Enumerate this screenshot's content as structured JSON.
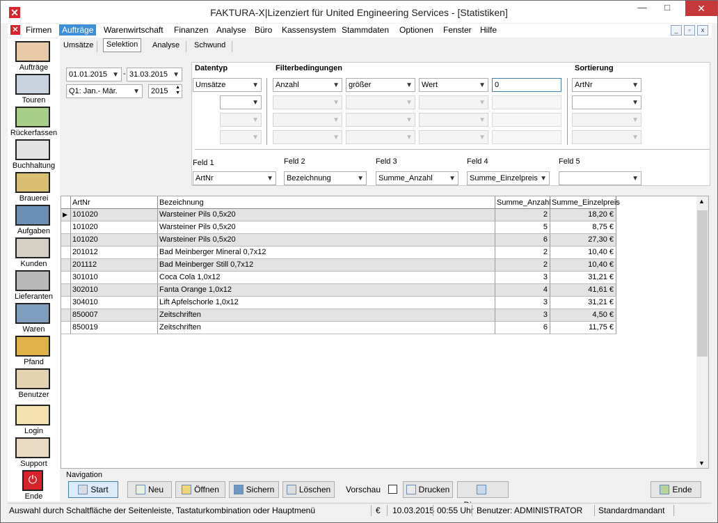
{
  "window": {
    "title": "FAKTURA-X|Lizenziert für United Engineering Services - [Statistiken]"
  },
  "menu": [
    "Firmen",
    "Aufträge",
    "Warenwirtschaft",
    "Finanzen",
    "Analyse",
    "Büro",
    "Kassensystem",
    "Stammdaten",
    "Optionen",
    "Fenster",
    "Hilfe"
  ],
  "sidebar": [
    "Aufträge",
    "Touren",
    "Rückerfassen",
    "Buchhaltung",
    "Brauerei",
    "Aufgaben",
    "Kunden",
    "Lieferanten",
    "Waren",
    "Pfand",
    "Benutzer",
    "Login",
    "Support",
    "Ende"
  ],
  "tabs": [
    "Umsätze",
    "Selektion",
    "Analyse",
    "Schwund"
  ],
  "period": {
    "from": "01.01.2015",
    "to": "31.03.2015",
    "quarter": "Q1: Jan.- Mär.",
    "year": "2015"
  },
  "filter": {
    "datentyp_header": "Datentyp",
    "filter_header": "Filterbedingungen",
    "sort_header": "Sortierung",
    "datentyp": "Umsätze",
    "feld": "Anzahl",
    "operator": "größer",
    "typ": "Wert",
    "wert": "0",
    "sortierung": "ArtNr"
  },
  "fields": {
    "labels": [
      "Feld 1",
      "Feld 2",
      "Feld 3",
      "Feld 4",
      "Feld 5"
    ],
    "values": [
      "ArtNr",
      "Bezeichnung",
      "Summe_Anzahl",
      "Summe_Einzelpreis",
      ""
    ]
  },
  "grid": {
    "columns": [
      "ArtNr",
      "Bezeichnung",
      "Summe_Anzahl",
      "Summe_Einzelpreis"
    ],
    "rows": [
      [
        "101020",
        "Warsteiner Pils 0,5x20",
        "2",
        "18,20 €"
      ],
      [
        "101020",
        "Warsteiner Pils 0,5x20",
        "5",
        "8,75 €"
      ],
      [
        "101020",
        "Warsteiner Pils 0,5x20",
        "6",
        "27,30 €"
      ],
      [
        "201012",
        "Bad Meinberger Mineral 0,7x12",
        "2",
        "10,40 €"
      ],
      [
        "201112",
        "Bad Meinberger Still 0,7x12",
        "2",
        "10,40 €"
      ],
      [
        "301010",
        "Coca Cola 1,0x12",
        "3",
        "31,21 €"
      ],
      [
        "302010",
        "Fanta Orange 1,0x12",
        "4",
        "41,61 €"
      ],
      [
        "304010",
        "Lift Apfelschorle 1,0x12",
        "3",
        "31,21 €"
      ],
      [
        "850007",
        "Zeitschriften",
        "3",
        "4,50 €"
      ],
      [
        "850019",
        "Zeitschriften",
        "6",
        "11,75 €"
      ]
    ]
  },
  "nav": {
    "label": "Navigation",
    "start": "Start",
    "neu": "Neu",
    "oeffnen": "Öffnen",
    "sichern": "Sichern",
    "loeschen": "Löschen",
    "vorschau": "Vorschau",
    "drucken": "Drucken",
    "diagramm": "Diagramm",
    "ende": "Ende"
  },
  "status": {
    "hint": "Auswahl durch Schaltfläche der Seitenleiste, Tastaturkombination oder Hauptmenü",
    "currency": "€",
    "date": "10.03.2015",
    "time": "00:55 Uhr",
    "user": "Benutzer: ADMINISTRATOR",
    "mandant": "Standardmandant"
  },
  "colors": {
    "accent": "#3c8fd8",
    "close": "#c7383a",
    "alt_row": "#e3e3e3"
  }
}
